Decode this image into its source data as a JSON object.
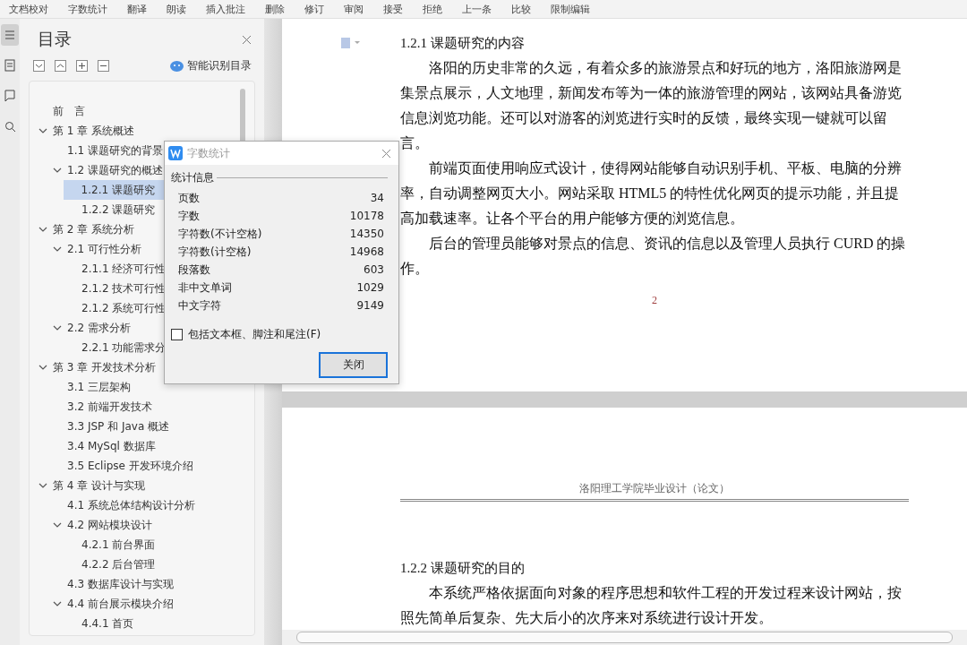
{
  "toolbar": {
    "items": [
      "文档校对",
      "字数统计",
      "翻译",
      "朗读",
      "插入批注",
      "删除",
      "修订",
      "审阅",
      "接受",
      "拒绝",
      "上一条",
      "比较",
      "限制编辑"
    ]
  },
  "toc_panel": {
    "title": "目录",
    "smart_button": "智能识别目录",
    "items": [
      {
        "label": "前　言",
        "selected": false
      },
      {
        "label": "第 1 章  系统概述",
        "expanded": true,
        "selected": false,
        "children": [
          {
            "label": "1.1  课题研究的背景",
            "selected": false
          },
          {
            "label": "1.2  课题研究的概述",
            "expanded": true,
            "selected": false,
            "children": [
              {
                "label": "1.2.1  课题研究",
                "selected": true
              },
              {
                "label": "1.2.2  课题研究",
                "selected": false
              }
            ]
          }
        ]
      },
      {
        "label": "第 2 章  系统分析",
        "expanded": true,
        "selected": false,
        "children": [
          {
            "label": "2.1  可行性分析",
            "expanded": true,
            "selected": false,
            "children": [
              {
                "label": "2.1.1  经济可行性",
                "selected": false
              },
              {
                "label": "2.1.2  技术可行性",
                "selected": false
              },
              {
                "label": "2.1.2  系统可行性",
                "selected": false
              }
            ]
          },
          {
            "label": "2.2  需求分析",
            "expanded": true,
            "selected": false,
            "children": [
              {
                "label": "2.2.1 功能需求分",
                "selected": false
              }
            ]
          }
        ]
      },
      {
        "label": "第 3 章  开发技术分析",
        "expanded": true,
        "selected": false,
        "children": [
          {
            "label": "3.1  三层架构",
            "selected": false
          },
          {
            "label": "3.2  前端开发技术",
            "selected": false
          },
          {
            "label": "3.3 JSP 和 Java 概述",
            "selected": false
          },
          {
            "label": "3.4 MySql 数据库",
            "selected": false
          },
          {
            "label": "3.5 Eclipse 开发环境介绍",
            "selected": false
          }
        ]
      },
      {
        "label": "第 4 章  设计与实现",
        "expanded": true,
        "selected": false,
        "children": [
          {
            "label": "4.1  系统总体结构设计分析",
            "selected": false
          },
          {
            "label": "4.2  网站模块设计",
            "expanded": true,
            "selected": false,
            "children": [
              {
                "label": "4.2.1  前台界面",
                "selected": false
              },
              {
                "label": "4.2.2  后台管理",
                "selected": false
              }
            ]
          },
          {
            "label": "4.3  数据库设计与实现",
            "selected": false
          },
          {
            "label": "4.4  前台展示模块介绍",
            "expanded": true,
            "selected": false,
            "children": [
              {
                "label": "4.4.1  首页",
                "selected": false
              }
            ]
          }
        ]
      }
    ]
  },
  "document": {
    "pages": [
      {
        "blocks": [
          {
            "kind": "heading",
            "text": "1.2.1  课题研究的内容"
          },
          {
            "kind": "paragraph",
            "text": "洛阳的历史非常的久远，有着众多的旅游景点和好玩的地方，洛阳旅游网是集景点展示，人文地理，新闻发布等为一体的旅游管理的网站，该网站具备游览信息浏览功能。还可以对游客的浏览进行实时的反馈，最终实现一键就可以留言。"
          },
          {
            "kind": "paragraph",
            "text": "前端页面使用响应式设计，使得网站能够自动识别手机、平板、电脑的分辨率，自动调整网页大小。网站采取 HTML5 的特性优化网页的提示功能，并且提高加载速率。让各个平台的用户能够方便的浏览信息。"
          },
          {
            "kind": "paragraph",
            "text": "后台的管理员能够对景点的信息、资讯的信息以及管理人员执行 CURD 的操作。"
          }
        ],
        "page_number": "2"
      },
      {
        "header": "洛阳理工学院毕业设计（论文）",
        "blocks": [
          {
            "kind": "heading",
            "text": "1.2.2  课题研究的目的"
          },
          {
            "kind": "paragraph",
            "text": "本系统严格依据面向对象的程序思想和软件工程的开发过程来设计网站，按照先简单后复杂、先大后小的次序来对系统进行设计开发。"
          }
        ]
      }
    ]
  },
  "dialog": {
    "title": "字数统计",
    "section": "统计信息",
    "stats": [
      {
        "label": "页数",
        "value": "34"
      },
      {
        "label": "字数",
        "value": "10178"
      },
      {
        "label": "字符数(不计空格)",
        "value": "14350"
      },
      {
        "label": "字符数(计空格)",
        "value": "14968"
      },
      {
        "label": "段落数",
        "value": "603"
      },
      {
        "label": "非中文单词",
        "value": "1029"
      },
      {
        "label": "中文字符",
        "value": "9149"
      }
    ],
    "checkbox": {
      "label": "包括文本框、脚注和尾注(F)",
      "checked": false
    },
    "button": "关闭"
  }
}
